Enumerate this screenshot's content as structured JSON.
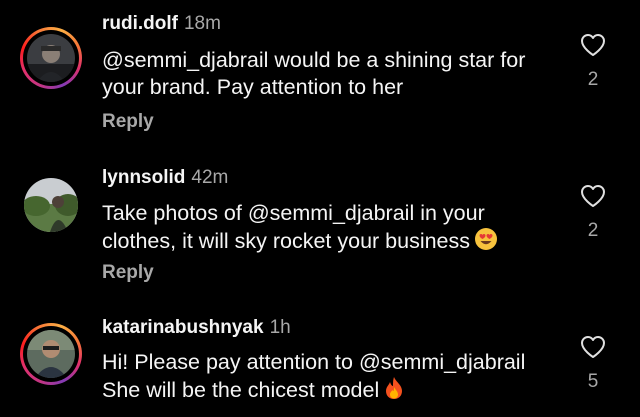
{
  "comments": [
    {
      "username": "rudi.dolf",
      "time": "18m",
      "text_line1": "@semmi_djabrail would be a shining star for",
      "text_line2": "your brand. Pay attention to her",
      "reply_label": "Reply",
      "likes": "2",
      "avatar_ring": "story"
    },
    {
      "username": "lynnsolid",
      "time": "42m",
      "text_line1": "Take photos of @semmi_djabrail in your",
      "text_line2": "clothes, it will sky rocket your business",
      "emoji": "heart-eyes-emoji",
      "reply_label": "Reply",
      "likes": "2",
      "avatar_ring": "none"
    },
    {
      "username": "katarinabushnyak",
      "time": "1h",
      "text_line1": "Hi! Please pay attention to @semmi_djabrail",
      "text_line2": "She will be the chicest model",
      "emoji": "fire-emoji",
      "likes": "5",
      "avatar_ring": "story"
    }
  ],
  "colors": {
    "background": "#000000",
    "primary_text": "#f5f5f5",
    "secondary_text": "#a8a8a8"
  }
}
